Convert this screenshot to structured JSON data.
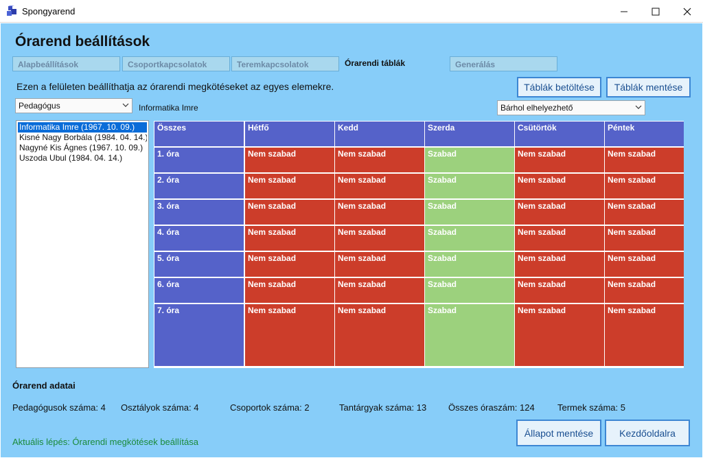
{
  "window": {
    "title": "Spongyarend",
    "icon": "cube-stack-icon",
    "controls": [
      "minimize-icon",
      "maximize-icon",
      "close-icon"
    ]
  },
  "heading": "Órarend beállítások",
  "tabs": [
    {
      "label": "Alapbeállítások",
      "active": false
    },
    {
      "label": "Csoportkapcsolatok",
      "active": false
    },
    {
      "label": "Teremkapcsolatok",
      "active": false
    },
    {
      "label": "Órarendi táblák",
      "active": true
    },
    {
      "label": "Generálás",
      "active": false
    }
  ],
  "description": "Ezen a felületen beállíthatja az órarendi megkötéseket az egyes elemekre.",
  "buttons": {
    "load_tables": "Táblák betöltése",
    "save_tables": "Táblák mentése",
    "save_state": "Állapot mentése",
    "home": "Kezdőoldalra"
  },
  "type_select": {
    "value": "Pedagógus"
  },
  "selected_name": "Informatika Imre",
  "placement_select": {
    "value": "Bárhol elhelyezhető"
  },
  "teachers": [
    {
      "label": "Informatika Imre (1967. 10. 09.)",
      "selected": true
    },
    {
      "label": "Kisné Nagy Borbála (1984. 04. 14.)",
      "selected": false
    },
    {
      "label": "Nagyné Kis Ágnes (1967. 10. 09.)",
      "selected": false
    },
    {
      "label": "Uszoda Ubul (1984. 04. 14.)",
      "selected": false
    }
  ],
  "timetable": {
    "corner": "Összes",
    "days": [
      "Hétfő",
      "Kedd",
      "Szerda",
      "Csütörtök",
      "Péntek"
    ],
    "periods": [
      "1. óra",
      "2. óra",
      "3. óra",
      "4. óra",
      "5. óra",
      "6. óra",
      "7. óra"
    ],
    "status_labels": {
      "busy": "Nem szabad",
      "free": "Szabad"
    },
    "status": [
      [
        "busy",
        "busy",
        "free",
        "busy",
        "busy"
      ],
      [
        "busy",
        "busy",
        "free",
        "busy",
        "busy"
      ],
      [
        "busy",
        "busy",
        "free",
        "busy",
        "busy"
      ],
      [
        "busy",
        "busy",
        "free",
        "busy",
        "busy"
      ],
      [
        "busy",
        "busy",
        "free",
        "busy",
        "busy"
      ],
      [
        "busy",
        "busy",
        "free",
        "busy",
        "busy"
      ],
      [
        "busy",
        "busy",
        "free",
        "busy",
        "busy"
      ]
    ],
    "colors": {
      "header": "#5562c9",
      "busy": "#cc3d2a",
      "free": "#9cd17d"
    }
  },
  "stats_title": "Órarend adatai",
  "stats": [
    "Pedagógusok száma: 4",
    "Osztályok száma: 4",
    "Csoportok száma: 2",
    "Tantárgyak száma: 13",
    "Összes óraszám: 124",
    "Termek száma: 5"
  ],
  "status_text": "Aktuális lépés: Órarendi megkötések beállítása"
}
